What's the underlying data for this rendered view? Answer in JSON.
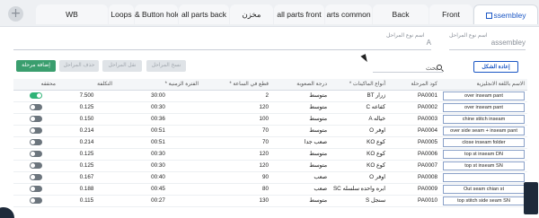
{
  "tabs": [
    {
      "label": "WB"
    },
    {
      "label": "Loops"
    },
    {
      "label": "& Button hole"
    },
    {
      "label": "all parts back"
    },
    {
      "label": "مخزن"
    },
    {
      "label": "all parts front"
    },
    {
      "label": "arts common"
    },
    {
      "label": "Back"
    },
    {
      "label": "Front"
    },
    {
      "label": "ssembley"
    }
  ],
  "form": {
    "stage_type_name_ar_label": "اسم نوع المراحل",
    "stage_type_name_ar_value": "A",
    "stage_type_name_en_label": "اسم نوع المراحل",
    "stage_type_name_en_value": "assembley"
  },
  "toolbar": {
    "add_stage": "إضافة مرحلة",
    "delete_stages": "حذف المراحل",
    "move_stages": "نقل المراحل",
    "copy_stages": "نسخ المراحل",
    "reshape": "إعادة الشكل",
    "search_label": "بحث"
  },
  "table": {
    "columns": [
      "الاسم باللغة الانجليزية",
      "كود المرحلة",
      "* أنواع الماكينات",
      "درجة الصعوبة",
      "* قطع في الساعة",
      "* الفترة الزمنية",
      "التكلفة",
      "محققه"
    ],
    "rows": [
      {
        "name": "over inseam pant",
        "code": "PA0001",
        "machine": "BT زرار",
        "difficulty": "متوسط",
        "pieces": "2",
        "period": "30:00",
        "cost": "7.500",
        "active": true
      },
      {
        "name": "over inseam pant",
        "code": "PA0002",
        "machine": "C كفاعه",
        "difficulty": "متوسط",
        "pieces": "120",
        "period": "00:30",
        "cost": "0.125",
        "active": false
      },
      {
        "name": "chine stitch inseam",
        "code": "PA0003",
        "machine": "A خياله",
        "difficulty": "متوسط",
        "pieces": "100",
        "period": "00:36",
        "cost": "0.150",
        "active": false
      },
      {
        "name": "over side seam + inseam pant",
        "code": "PA0004",
        "machine": "O اوفر",
        "difficulty": "متوسط",
        "pieces": "70",
        "period": "00:51",
        "cost": "0.214",
        "active": false
      },
      {
        "name": "close inseam folder",
        "code": "PA0005",
        "machine": "KO كوع",
        "difficulty": "صعب جدا",
        "pieces": "70",
        "period": "00:51",
        "cost": "0.214",
        "active": false
      },
      {
        "name": "top st inseam DN",
        "code": "PA0006",
        "machine": "KO كوع",
        "difficulty": "متوسط",
        "pieces": "120",
        "period": "00:30",
        "cost": "0.125",
        "active": false
      },
      {
        "name": "top st inseam SN",
        "code": "PA0007",
        "machine": "KO كوع",
        "difficulty": "متوسط",
        "pieces": "120",
        "period": "00:30",
        "cost": "0.125",
        "active": false
      },
      {
        "name": "",
        "code": "PA0008",
        "machine": "O اوفر",
        "difficulty": "صعب",
        "pieces": "90",
        "period": "00:40",
        "cost": "0.167",
        "active": false
      },
      {
        "name": "Out seam chian st",
        "code": "PA0009",
        "machine": "SC ابره واحده سلسله",
        "difficulty": "صعب",
        "pieces": "80",
        "period": "00:45",
        "cost": "0.188",
        "active": false
      },
      {
        "name": "top stitch side seam SN",
        "code": "PA0010",
        "machine": "S سنجل",
        "difficulty": "متوسط",
        "pieces": "130",
        "period": "00:27",
        "cost": "0.115",
        "active": false
      }
    ]
  }
}
